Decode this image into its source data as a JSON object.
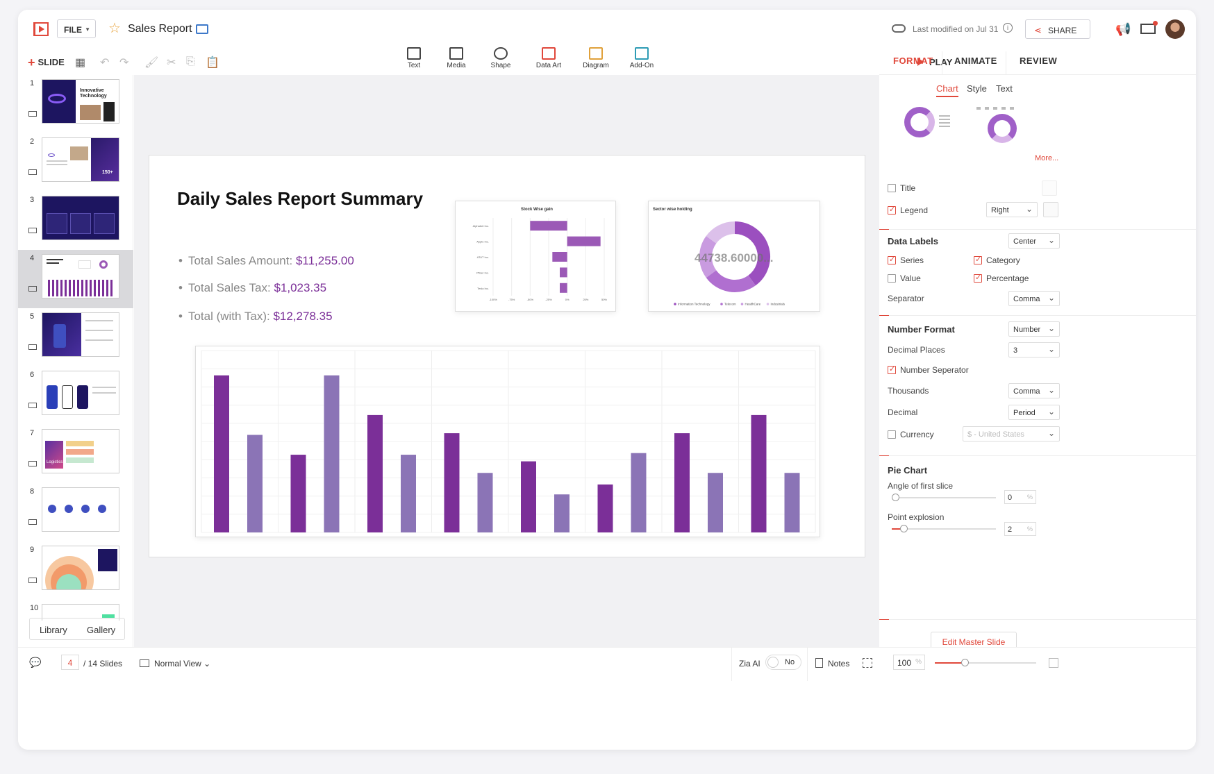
{
  "header": {
    "file_label": "FILE",
    "doc_title": "Sales Report",
    "last_modified": "Last modified on Jul 31",
    "share_label": "SHARE"
  },
  "toolbar": {
    "slide_label": "SLIDE",
    "insert_items": [
      {
        "label": "Text"
      },
      {
        "label": "Media"
      },
      {
        "label": "Shape"
      },
      {
        "label": "Data Art"
      },
      {
        "label": "Diagram"
      },
      {
        "label": "Add-On"
      }
    ],
    "play_label": "PLAY"
  },
  "panel_tabs": [
    "FORMAT",
    "ANIMATE",
    "REVIEW"
  ],
  "thumbnails": [
    {
      "num": "1",
      "text": "Innovative Technology"
    },
    {
      "num": "2"
    },
    {
      "num": "3"
    },
    {
      "num": "4",
      "selected": true
    },
    {
      "num": "5"
    },
    {
      "num": "6"
    },
    {
      "num": "7",
      "text": "Logistics"
    },
    {
      "num": "8"
    },
    {
      "num": "9"
    },
    {
      "num": "10"
    }
  ],
  "thumb_extra": {
    "slide2_stat": "150+"
  },
  "left_footer": {
    "library": "Library",
    "gallery": "Gallery"
  },
  "slide": {
    "title": "Daily Sales Report Summary",
    "bullets": [
      {
        "label": "Total Sales Amount:",
        "value": "$11,255.00"
      },
      {
        "label": "Total Sales Tax:",
        "value": "$1,023.35"
      },
      {
        "label": "Total (with Tax):",
        "value": "$12,278.35"
      }
    ]
  },
  "chart_data": [
    {
      "type": "bar",
      "orientation": "horizontal",
      "title": "Stock Wise gain",
      "categories": [
        "Alphabet Inc.",
        "Apple Inc.",
        "AT&T Inc.",
        "Pfizer Inc.",
        "Tesla Inc."
      ],
      "values": [
        -50,
        45,
        -20,
        -10,
        -10
      ],
      "x_ticks": [
        "-100%",
        "-75%",
        "-50%",
        "-25%",
        "0%",
        "25%",
        "50%"
      ],
      "xlim": [
        -100,
        50
      ],
      "color": "#9b59b6"
    },
    {
      "type": "pie",
      "title": "Sector wise holding",
      "center_label": "44738.60000...",
      "categories": [
        "Information Technology",
        "Telecom",
        "HealthCare",
        "Industrials"
      ],
      "values": [
        40,
        25,
        20,
        15
      ],
      "colors": [
        "#9b4fbf",
        "#b06fd0",
        "#c99be0",
        "#dcc0ea"
      ]
    },
    {
      "type": "bar",
      "title": "",
      "values": [
        95,
        59,
        47,
        95,
        71,
        47,
        60,
        36,
        43,
        23,
        29,
        48,
        60,
        36,
        71,
        36
      ],
      "ylim": [
        0,
        110
      ],
      "colors": [
        "#7b2f98",
        "#8b74b6"
      ],
      "grid": true
    }
  ],
  "right_panel": {
    "subtabs": [
      "Chart",
      "Style",
      "Text"
    ],
    "more": "More...",
    "title_label": "Title",
    "legend_label": "Legend",
    "legend_pos": "Right",
    "data_labels": {
      "heading": "Data Labels",
      "position": "Center",
      "series": "Series",
      "category": "Category",
      "value": "Value",
      "percentage": "Percentage",
      "separator_label": "Separator",
      "separator": "Comma"
    },
    "number_format": {
      "heading": "Number Format",
      "format": "Number",
      "decimal_places_label": "Decimal Places",
      "decimal_places": "3",
      "number_separator": "Number Seperator",
      "thousands_label": "Thousands",
      "thousands": "Comma",
      "decimal_label": "Decimal",
      "decimal": "Period",
      "currency_label": "Currency",
      "currency": "$ - United States"
    },
    "pie_chart": {
      "heading": "Pie Chart",
      "angle_label": "Angle of first slice",
      "angle": "0",
      "explosion_label": "Point explosion",
      "explosion": "2",
      "unit": "%"
    },
    "edit_master": "Edit Master Slide"
  },
  "status": {
    "current_slide": "4",
    "total": "/ 14 Slides",
    "view": "Normal View",
    "zia": "Zia AI",
    "zia_toggle": "No",
    "notes": "Notes",
    "zoom": "100",
    "zoom_unit": "%"
  }
}
